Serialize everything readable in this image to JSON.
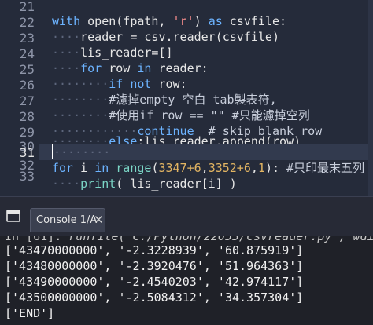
{
  "editor": {
    "line_numbers": [
      "21",
      "22",
      "23",
      "24",
      "25",
      "26",
      "27",
      "28",
      "29",
      "30",
      "31",
      "32",
      "33"
    ],
    "current_line": "31",
    "code": {
      "l22_kw": "with",
      "l22_a": " open(fpath, ",
      "l22_str": "'r'",
      "l22_b": ") ",
      "l22_kw2": "as",
      "l22_c": " csvfile:",
      "l23_ws": "····",
      "l23": "reader = csv.reader(csvfile)",
      "l24_ws": "····",
      "l24": "lis_reader=[]",
      "l25_ws": "····",
      "l25_kw": "for",
      "l25_a": " row ",
      "l25_kw2": "in",
      "l25_b": " reader:",
      "l26_ws": "········",
      "l26_kw": "if not",
      "l26_a": " row:",
      "l27_ws": "········",
      "l27_cm": "#濾掉empty 空白 tab製表符,",
      "l28_ws": "········",
      "l28_cm": "#使用if row == \"\" #只能濾掉空列",
      "l29_ws": "············",
      "l29_kw": "continue",
      "l29_cm": "  # skip blank row",
      "l30_ws": "········",
      "l30_kw": "else",
      "l30_a": ":lis_reader.append(row)",
      "l31_ws": "········",
      "l32_kw": "for",
      "l32_a": " i ",
      "l32_kw2": "in",
      "l32_b": " ",
      "l32_fn": "range",
      "l32_c": "(",
      "l32_num1": "3347+6",
      "l32_d": ",",
      "l32_num2": "3352+6",
      "l32_e": ",",
      "l32_num3": "1",
      "l32_f": "): ",
      "l32_cm": "#只印最末五列",
      "l33_ws": "····",
      "l33_fn": "print",
      "l33_a": "( lis_reader[i] )"
    }
  },
  "console": {
    "tab_label": "Console 1/A",
    "close_glyph": "✕",
    "icon": "console-window-icon",
    "cut_line_a": "In [61]: ",
    "cut_line_b": "runfile('C:/Python/22053/csvreader.py', wdi",
    "output": [
      "['43470000000', '-2.3228939', '60.875919']",
      "['43480000000', '-2.3920476', '51.964363']",
      "['43490000000', '-2.4540203', '42.974117']",
      "['43500000000', '-2.5084312', '34.357304']",
      "['END']"
    ]
  }
}
